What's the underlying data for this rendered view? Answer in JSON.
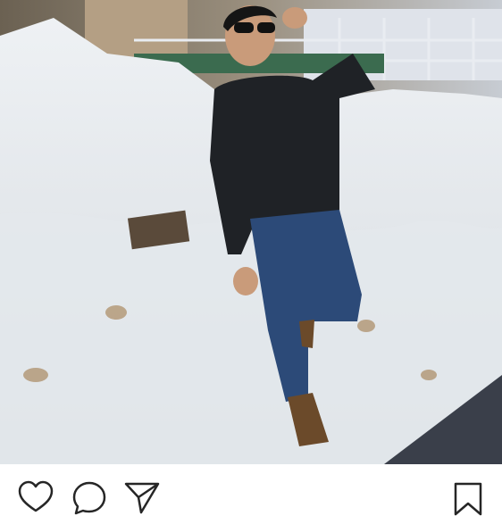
{
  "post": {
    "photo": {
      "description_icon": "photo",
      "subject": "man-posing-on-snow"
    },
    "actions": {
      "like_icon": "heart-outline-icon",
      "comment_icon": "comment-bubble-icon",
      "share_icon": "paper-plane-icon",
      "save_icon": "bookmark-icon"
    },
    "colors": {
      "icon_stroke": "#262626",
      "background": "#ffffff"
    }
  }
}
